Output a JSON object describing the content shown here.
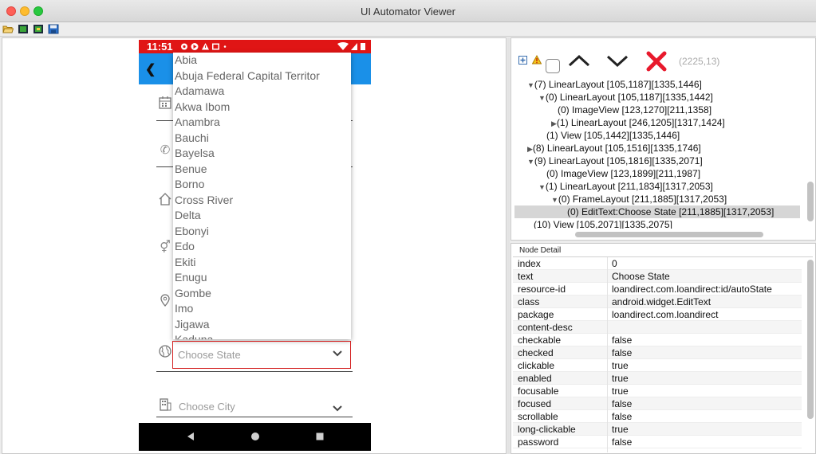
{
  "window": {
    "title": "UI Automator Viewer"
  },
  "toolbar": {
    "icons": [
      "open-folder-icon",
      "device-screenshot-icon",
      "device-screenshot-compressed-icon",
      "save-icon"
    ]
  },
  "phone": {
    "status_time": "11:51",
    "state_list": [
      "Abia",
      "Abuja Federal Capital Territor",
      "Adamawa",
      "Akwa Ibom",
      "Anambra",
      "Bauchi",
      "Bayelsa",
      "Benue",
      "Borno",
      "Cross River",
      "Delta",
      "Ebonyi",
      "Edo",
      "Ekiti",
      "Enugu",
      "Gombe",
      "Imo",
      "Jigawa",
      "Kaduna"
    ],
    "choose_state": "Choose State",
    "choose_city": "Choose City"
  },
  "hierarchy": {
    "coords": "(2225,13)",
    "rows": [
      {
        "text": "(7) LinearLayout [105,1187][1335,1446]",
        "arrow": "▼"
      },
      {
        "text": "(0) LinearLayout [105,1187][1335,1442]",
        "arrow": "▼"
      },
      {
        "text": "(0) ImageView [123,1270][211,1358]",
        "arrow": ""
      },
      {
        "text": "(1) LinearLayout [246,1205][1317,1424]",
        "arrow": "▶"
      },
      {
        "text": "(1) View [105,1442][1335,1446]",
        "arrow": ""
      },
      {
        "text": "(8) LinearLayout [105,1516][1335,1746]",
        "arrow": "▶"
      },
      {
        "text": "(9) LinearLayout [105,1816][1335,2071]",
        "arrow": "▼"
      },
      {
        "text": "(0) ImageView [123,1899][211,1987]",
        "arrow": ""
      },
      {
        "text": "(1) LinearLayout [211,1834][1317,2053]",
        "arrow": "▼"
      },
      {
        "text": "(0) FrameLayout [211,1885][1317,2053]",
        "arrow": "▼"
      },
      {
        "text": "(0) EditText:Choose State [211,1885][1317,2053]",
        "arrow": ""
      },
      {
        "text": "(10) View [105,2071][1335,2075]",
        "arrow": ""
      }
    ]
  },
  "node_detail": {
    "title": "Node Detail",
    "rows": [
      {
        "key": "index",
        "value": "0"
      },
      {
        "key": "text",
        "value": "Choose State"
      },
      {
        "key": "resource-id",
        "value": "loandirect.com.loandirect:id/autoState"
      },
      {
        "key": "class",
        "value": "android.widget.EditText"
      },
      {
        "key": "package",
        "value": "loandirect.com.loandirect"
      },
      {
        "key": "content-desc",
        "value": ""
      },
      {
        "key": "checkable",
        "value": "false"
      },
      {
        "key": "checked",
        "value": "false"
      },
      {
        "key": "clickable",
        "value": "true"
      },
      {
        "key": "enabled",
        "value": "true"
      },
      {
        "key": "focusable",
        "value": "true"
      },
      {
        "key": "focused",
        "value": "false"
      },
      {
        "key": "scrollable",
        "value": "false"
      },
      {
        "key": "long-clickable",
        "value": "true"
      },
      {
        "key": "password",
        "value": "false"
      }
    ]
  },
  "colors": {
    "status_bar": "#e01515",
    "app_bar": "#1a90e8",
    "highlight": "#d32020",
    "delete_x": "#e8192c"
  }
}
